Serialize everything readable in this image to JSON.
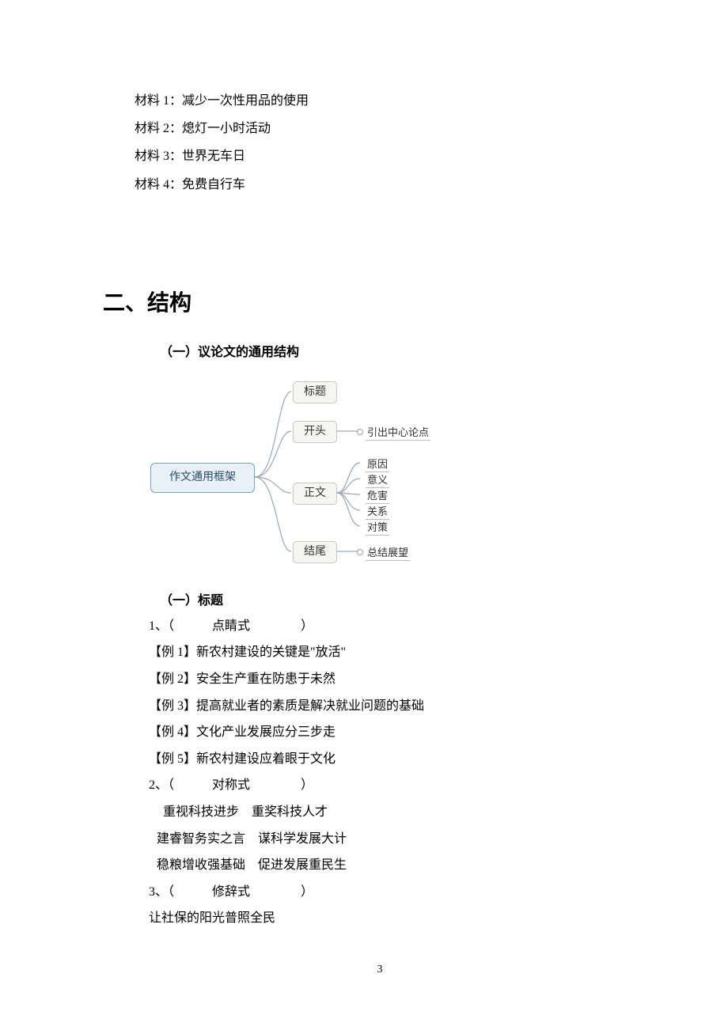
{
  "materials": {
    "m1": "材料 1：减少一次性用品的使用",
    "m2": "材料 2：熄灯一小时活动",
    "m3": "材料 3：世界无车日",
    "m4": "材料 4：免费自行车"
  },
  "section2": {
    "heading": "二、结构",
    "sub1_heading": "（一）议论文的通用结构",
    "diagram": {
      "root": "作文通用框架",
      "n_title": "标题",
      "n_open": "开头",
      "n_body": "正文",
      "n_end": "结尾",
      "open_leaf": "引出中心论点",
      "body_leaves": {
        "l1": "原因",
        "l2": "意义",
        "l3": "危害",
        "l4": "关系",
        "l5": "对策"
      },
      "end_leaf": "总结展望"
    },
    "sub2_heading": "（一）标题",
    "titles": {
      "type1_label": "1、（　　　点睛式　　　　）",
      "type1_examples": {
        "e1": "【例 1】新农村建设的关键是\"放活\"",
        "e2": "【例 2】安全生产重在防患于未然",
        "e3": "【例 3】提高就业者的素质是解决就业问题的基础",
        "e4": "【例 4】文化产业发展应分三步走",
        "e5": "【例 5】新农村建设应着眼于文化"
      },
      "type2_label": "2、（　　　对称式　　　　）",
      "type2_examples": {
        "e1": "重视科技进步　重奖科技人才",
        "e2": "建睿智务实之言　谋科学发展大计",
        "e3": "稳粮增收强基础　促进发展重民生"
      },
      "type3_label": "3、（　　　修辞式　　　　）",
      "type3_example": "让社保的阳光普照全民"
    }
  },
  "page_number": "3"
}
